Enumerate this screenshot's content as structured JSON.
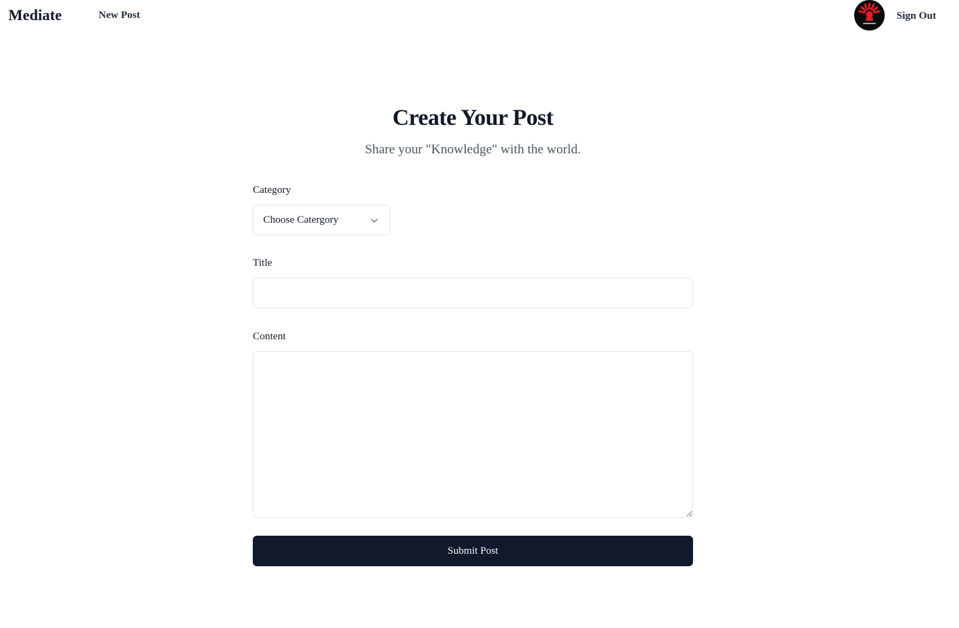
{
  "nav": {
    "brand": "Mediate",
    "new_post": "New Post",
    "sign_out": "Sign Out",
    "avatar_icon": "avatar-logo",
    "avatar_color": "#e11d2a"
  },
  "page": {
    "title": "Create Your Post",
    "subtitle": "Share your \"Knowledge\" with the world."
  },
  "form": {
    "category_label": "Category",
    "category_value": "Choose Catergory",
    "title_label": "Title",
    "title_value": "",
    "content_label": "Content",
    "content_value": "",
    "submit_label": "Submit Post"
  },
  "colors": {
    "primary_button": "#111a2c",
    "text": "#111827",
    "muted_text": "#4b5563",
    "border": "#e5e7eb"
  }
}
